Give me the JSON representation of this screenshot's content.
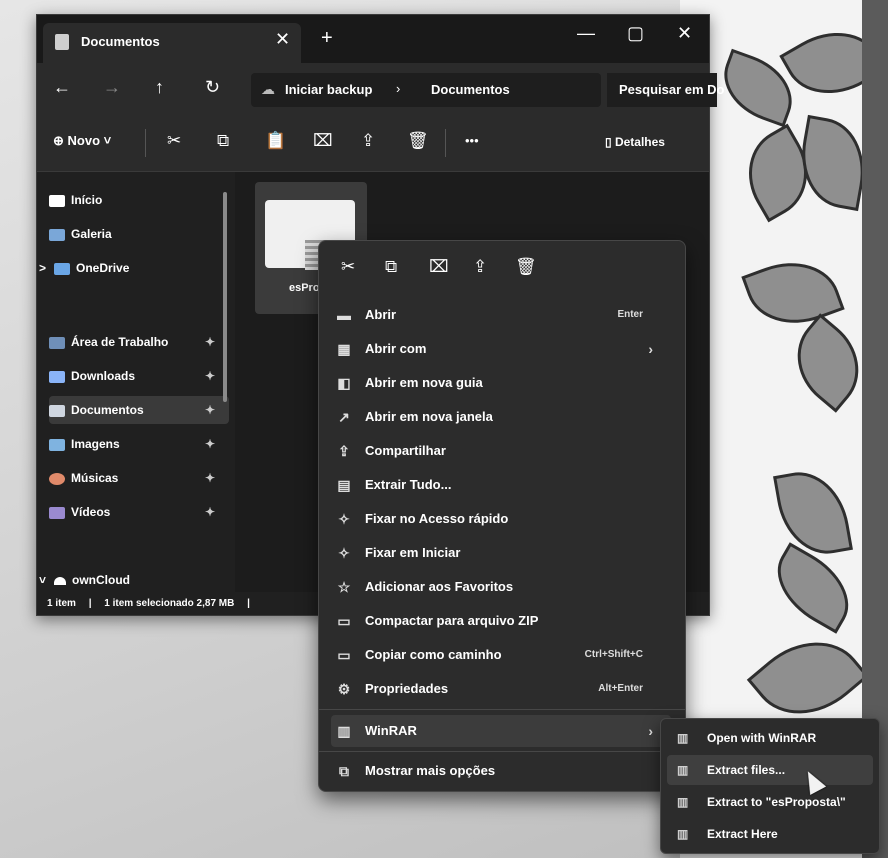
{
  "window": {
    "tab_title": "Documentos",
    "tab_close": "✕",
    "new_tab": "+",
    "minimize": "—",
    "maximize": "▢",
    "close": "✕"
  },
  "nav": {
    "back": "←",
    "forward": "→",
    "up": "↑",
    "refresh": "↻",
    "breadcrumb": [
      "Iniciar backup",
      "Documentos"
    ],
    "breadcrumb_sep": "›",
    "search_placeholder": "Pesquisar em Do"
  },
  "toolbar": {
    "new_label": "⊕ Novo ˅",
    "more": "•••",
    "details_label": "Detalhes"
  },
  "sidebar": {
    "items": [
      {
        "label": "Início",
        "color": "#ffffff"
      },
      {
        "label": "Galeria",
        "color": "#7aa7d8"
      },
      {
        "label": "OneDrive",
        "color": "#6aa6e6",
        "expand": ">"
      },
      {
        "label": "Área de Trabalho",
        "color": "#6f8fb8",
        "pin": "📌"
      },
      {
        "label": "Downloads",
        "color": "#8ab4f8",
        "pin": "📌"
      },
      {
        "label": "Documentos",
        "color": "#cfd6e0",
        "pin": "📌"
      },
      {
        "label": "Imagens",
        "color": "#7fb3e0",
        "pin": "📌"
      },
      {
        "label": "Músicas",
        "color": "#e08a6a",
        "pin": "📌"
      },
      {
        "label": "Vídeos",
        "color": "#9a8ad0",
        "pin": "📌"
      },
      {
        "label": "ownCloud",
        "color": "#ffffff",
        "expand": "˅"
      }
    ]
  },
  "file": {
    "name": "esPropo"
  },
  "status": {
    "count": "1 item",
    "selected": "1 item selecionado 2,87 MB"
  },
  "context_menu": {
    "items": [
      {
        "label": "Abrir",
        "shortcut": "Enter",
        "icon": "▬"
      },
      {
        "label": "Abrir com",
        "arrow": "›",
        "icon": "▦"
      },
      {
        "label": "Abrir em nova guia",
        "icon": "◧"
      },
      {
        "label": "Abrir em nova janela",
        "icon": "↗"
      },
      {
        "label": "Compartilhar",
        "icon": "⇪"
      },
      {
        "label": "Extrair Tudo...",
        "icon": "▤"
      },
      {
        "label": "Fixar no Acesso rápido",
        "icon": "✧"
      },
      {
        "label": "Fixar em Iniciar",
        "icon": "✧"
      },
      {
        "label": "Adicionar aos Favoritos",
        "icon": "☆"
      },
      {
        "label": "Compactar para arquivo ZIP",
        "icon": "▭"
      },
      {
        "label": "Copiar como caminho",
        "shortcut": "Ctrl+Shift+C",
        "icon": "▭"
      },
      {
        "label": "Propriedades",
        "shortcut": "Alt+Enter",
        "icon": "⚙"
      },
      {
        "label": "WinRAR",
        "arrow": "›",
        "icon": "▥"
      },
      {
        "label": "Mostrar mais opções",
        "icon": "⧉"
      }
    ]
  },
  "winrar_submenu": {
    "items": [
      {
        "label": "Open with WinRAR"
      },
      {
        "label": "Extract files..."
      },
      {
        "label": "Extract to \"esProposta\\\""
      },
      {
        "label": "Extract Here"
      }
    ]
  }
}
